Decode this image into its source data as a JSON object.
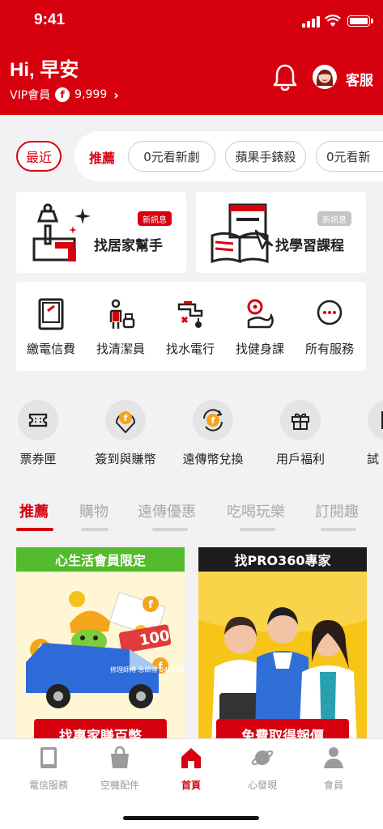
{
  "status_bar": {
    "time": "9:41"
  },
  "header": {
    "greeting": "Hi, 早安",
    "vip_label": "VIP會員",
    "coin_symbol": "f",
    "points": "9,999",
    "chevron": "›",
    "customer_service": "客服",
    "brand_color": "#d7000f"
  },
  "chips": {
    "recent": "最近",
    "recommend": "推薦",
    "items": [
      "0元看新劇",
      "蘋果手錶殺",
      "0元看新"
    ]
  },
  "feature_cards": [
    {
      "label": "找居家幫手",
      "badge": "新訊息",
      "badge_color": "#d7000f",
      "icon": "home-helper-icon"
    },
    {
      "label": "找學習課程",
      "badge": "新訊息",
      "badge_color": "#c4c4c8",
      "icon": "learning-course-icon"
    }
  ],
  "services": [
    {
      "label": "繳電信費",
      "icon": "phone-bill-icon"
    },
    {
      "label": "找清潔員",
      "icon": "cleaner-icon"
    },
    {
      "label": "找水電行",
      "icon": "plumber-icon"
    },
    {
      "label": "找健身課",
      "icon": "fitness-icon"
    },
    {
      "label": "所有服務",
      "icon": "more-services-icon"
    }
  ],
  "quick_actions": [
    {
      "label": "票券匣",
      "icon": "ticket-icon"
    },
    {
      "label": "簽到與賺幣",
      "icon": "checkin-coin-icon"
    },
    {
      "label": "遠傳幣兌換",
      "icon": "coin-exchange-icon"
    },
    {
      "label": "用戶福利",
      "icon": "gift-icon"
    },
    {
      "label": "試",
      "icon": "trial-icon"
    }
  ],
  "content_tabs": [
    {
      "label": "推薦",
      "active": true
    },
    {
      "label": "購物",
      "active": false
    },
    {
      "label": "遠傳優惠",
      "active": false
    },
    {
      "label": "吃喝玩樂",
      "active": false
    },
    {
      "label": "訂閱趣",
      "active": false
    }
  ],
  "promos": [
    {
      "header": "心生活會員限定",
      "header_color": "#54ba2e",
      "button": "找專家賺百幣",
      "truck_text": "修理師傅 急師傅 24HR開箱 購買",
      "badge_text": "100",
      "coin_symbol": "f"
    },
    {
      "header": "找PRO360專家",
      "header_color": "#1c1c1c",
      "button": "免費取得報價"
    }
  ],
  "bottom_nav": [
    {
      "label": "電信服務",
      "icon": "telecom-icon",
      "active": false
    },
    {
      "label": "空機配件",
      "icon": "shopping-bag-icon",
      "active": false
    },
    {
      "label": "首頁",
      "icon": "home-icon",
      "active": true
    },
    {
      "label": "心發現",
      "icon": "planet-icon",
      "active": false
    },
    {
      "label": "會員",
      "icon": "member-icon",
      "active": false
    }
  ]
}
